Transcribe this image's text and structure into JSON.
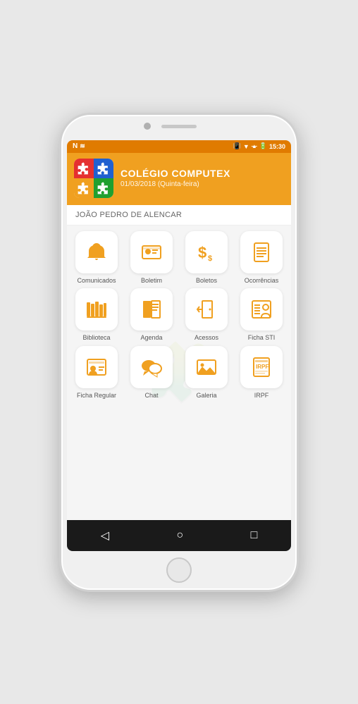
{
  "phone": {
    "status_bar": {
      "time": "15:30",
      "icons_left": [
        "N",
        "signal"
      ],
      "icons_right": [
        "vibrate",
        "wifi",
        "no-signal",
        "battery"
      ]
    },
    "header": {
      "school_name": "COLÉGIO COMPUTEX",
      "school_date": "01/03/2018 (Quinta-feira)",
      "user_name": "JOÃO PEDRO DE ALENCAR"
    },
    "apps": [
      {
        "id": "comunicados",
        "label": "Comunicados",
        "icon": "bell"
      },
      {
        "id": "boletim",
        "label": "Boletim",
        "icon": "id-card"
      },
      {
        "id": "boletos",
        "label": "Boletos",
        "icon": "dollar"
      },
      {
        "id": "ocorrencias",
        "label": "Ocorrências",
        "icon": "document-lines"
      },
      {
        "id": "biblioteca",
        "label": "Biblioteca",
        "icon": "books"
      },
      {
        "id": "agenda",
        "label": "Agenda",
        "icon": "book-open"
      },
      {
        "id": "acessos",
        "label": "Acessos",
        "icon": "door-arrow"
      },
      {
        "id": "ficha-sti",
        "label": "Ficha STI",
        "icon": "person-lines"
      },
      {
        "id": "ficha-regular",
        "label": "Ficha Regular",
        "icon": "person-card"
      },
      {
        "id": "chat",
        "label": "Chat",
        "icon": "chat-bubbles"
      },
      {
        "id": "galeria",
        "label": "Galeria",
        "icon": "image-mountains"
      },
      {
        "id": "irpf",
        "label": "IRPF",
        "icon": "irpf-doc"
      }
    ],
    "nav_bar": {
      "back_label": "◁",
      "home_label": "○",
      "recent_label": "□"
    }
  }
}
